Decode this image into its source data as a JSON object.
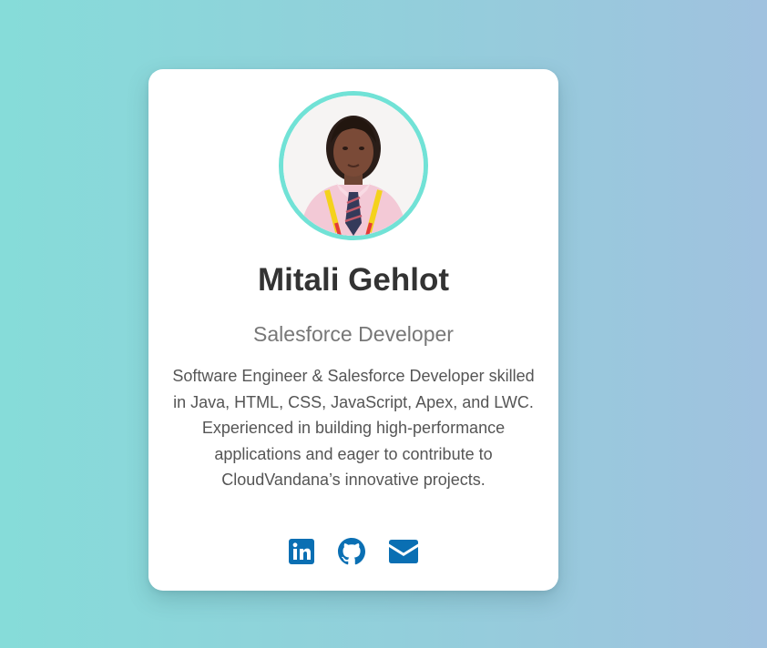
{
  "profile": {
    "name": "Mitali Gehlot",
    "role": "Salesforce Developer",
    "bio": "Software Engineer & Salesforce Developer skilled in Java, HTML, CSS, JavaScript, Apex, and LWC. Experienced in building high-performance applications and eager to contribute to CloudVandana’s innovative projects."
  },
  "social": {
    "items": [
      {
        "icon": "linkedin-icon"
      },
      {
        "icon": "github-icon"
      },
      {
        "icon": "envelope-icon"
      }
    ]
  },
  "colors": {
    "background_start": "#86dcd9",
    "background_end": "#a0c2df",
    "avatar_border": "#71e2d6",
    "icon_color": "#0a6fb3",
    "name_color": "#333333",
    "role_color": "#777777",
    "bio_color": "#555555"
  }
}
